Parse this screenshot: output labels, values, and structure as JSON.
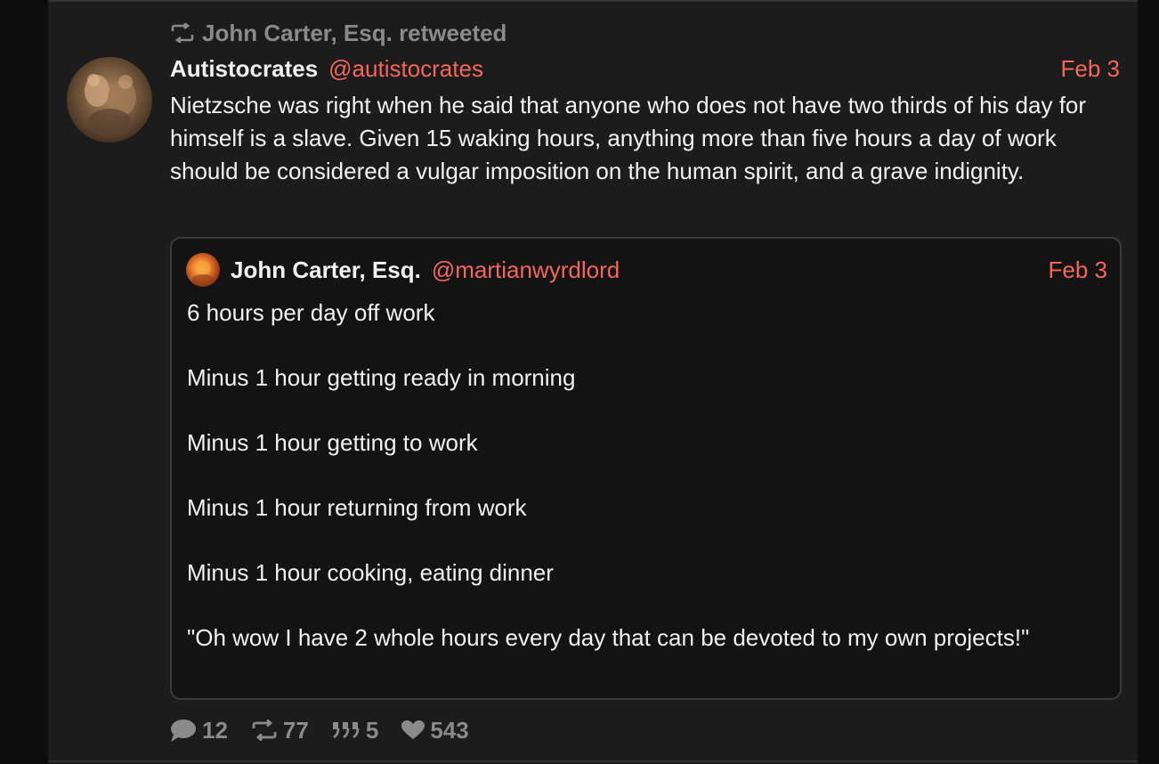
{
  "retweet": {
    "icon": "retweet-icon",
    "label": "John Carter, Esq. retweeted"
  },
  "tweet": {
    "avatar_icon": "profile-avatar",
    "author_name": "Autistocrates",
    "author_handle": "@autistocrates",
    "date": "Feb 3",
    "text": "Nietzsche was right when he said that anyone who does not have two thirds of his day for himself is a slave. Given 15 waking hours, anything more than five hours a day of work should be considered a vulgar imposition on the human spirit, and a grave indignity."
  },
  "quoted_tweet": {
    "avatar_icon": "profile-avatar",
    "author_name": "John Carter, Esq.",
    "author_handle": "@martianwyrdlord",
    "date": "Feb 3",
    "text": "6 hours per day off work\n\nMinus 1 hour getting ready in morning\n\nMinus 1 hour getting to work\n\nMinus 1 hour returning from work\n\nMinus 1 hour cooking, eating dinner\n\n\"Oh wow I have 2 whole hours every day that can be devoted to my own projects!\""
  },
  "actions": {
    "replies": {
      "icon": "comment-icon",
      "count": "12"
    },
    "retweets": {
      "icon": "retweet-icon",
      "count": "77"
    },
    "quotes": {
      "icon": "quote-icon",
      "count": "5"
    },
    "likes": {
      "icon": "heart-icon",
      "count": "543"
    }
  },
  "colors": {
    "accent": "#f4665a",
    "text": "#f2f2f2",
    "muted": "#8a8a8a",
    "background": "#1c1c1c"
  }
}
